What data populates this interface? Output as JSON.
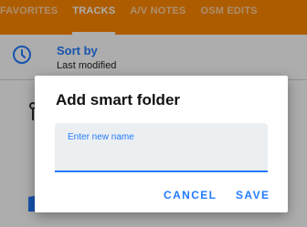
{
  "tabs": [
    {
      "label": "FAVORITES",
      "active": false
    },
    {
      "label": "TRACKS",
      "active": true
    },
    {
      "label": "A/V NOTES",
      "active": false
    },
    {
      "label": "OSM EDITS",
      "active": false
    }
  ],
  "sort": {
    "title": "Sort by",
    "subtitle": "Last modified"
  },
  "background_fragment": "",
  "dialog": {
    "title": "Add smart folder",
    "input_label": "Enter new name",
    "input_value": "",
    "cancel_label": "CANCEL",
    "save_label": "SAVE"
  },
  "colors": {
    "header": "#ff8800",
    "accent": "#237bff",
    "field_bg": "#eceff1",
    "scrim": "rgba(0,0,0,0.32)"
  },
  "icons": [
    "clock-icon",
    "track-icon",
    "folder-icon"
  ]
}
